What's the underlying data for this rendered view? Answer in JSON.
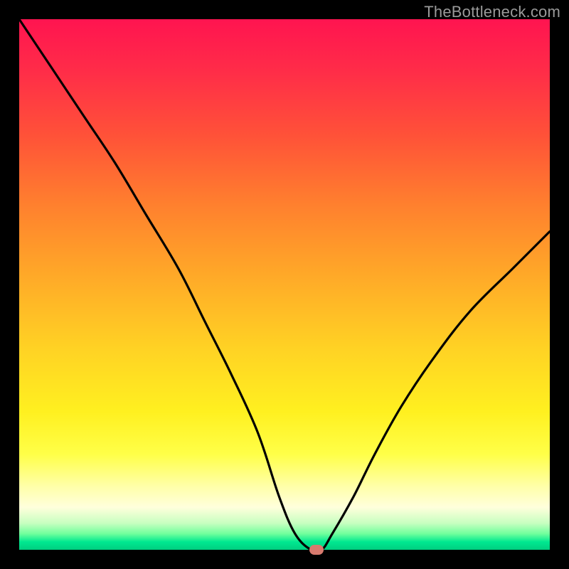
{
  "watermark": "TheBottleneck.com",
  "chart_data": {
    "type": "line",
    "title": "",
    "xlabel": "",
    "ylabel": "",
    "xlim": [
      0,
      100
    ],
    "ylim": [
      0,
      100
    ],
    "series": [
      {
        "name": "bottleneck-curve",
        "x": [
          0,
          6,
          12,
          18,
          24,
          30,
          35,
          40,
          45,
          49,
          52,
          55,
          57,
          59,
          63,
          67,
          72,
          78,
          85,
          93,
          100
        ],
        "values": [
          100,
          91,
          82,
          73,
          63,
          53,
          43,
          33,
          22,
          10,
          3,
          0,
          0,
          3,
          10,
          18,
          27,
          36,
          45,
          53,
          60
        ]
      }
    ],
    "marker": {
      "x": 56,
      "y": 0,
      "color": "#d87a6e"
    },
    "gradient_stops": [
      {
        "pos": 0,
        "color": "#ff1450"
      },
      {
        "pos": 0.35,
        "color": "#ff802e"
      },
      {
        "pos": 0.74,
        "color": "#fff020"
      },
      {
        "pos": 0.92,
        "color": "#ffffdc"
      },
      {
        "pos": 1.0,
        "color": "#00ce80"
      }
    ]
  }
}
